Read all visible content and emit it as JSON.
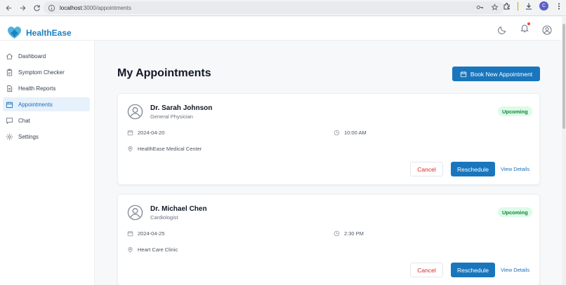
{
  "browser": {
    "url_host": "localhost",
    "url_path": ":3000/appointments",
    "profile_initial": "C"
  },
  "app": {
    "name": "HealthEase"
  },
  "sidebar": {
    "items": [
      {
        "label": "Dashboard",
        "icon": "home-icon"
      },
      {
        "label": "Symptom Checker",
        "icon": "clipboard-icon"
      },
      {
        "label": "Health Reports",
        "icon": "document-icon"
      },
      {
        "label": "Appointments",
        "icon": "calendar-icon",
        "active": true
      },
      {
        "label": "Chat",
        "icon": "chat-icon"
      },
      {
        "label": "Settings",
        "icon": "gear-icon"
      }
    ]
  },
  "main": {
    "title": "My Appointments",
    "book_button": "Book New Appointment"
  },
  "appointments": [
    {
      "doctor": "Dr. Sarah Johnson",
      "specialty": "General Physician",
      "status": "Upcoming",
      "date": "2024-04-20",
      "time": "10:00 AM",
      "location": "HealthEase Medical Center",
      "cancel": "Cancel",
      "reschedule": "Reschedule",
      "details": "View Details"
    },
    {
      "doctor": "Dr. Michael Chen",
      "specialty": "Cardiologist",
      "status": "Upcoming",
      "date": "2024-04-25",
      "time": "2:30 PM",
      "location": "Heart Care Clinic",
      "cancel": "Cancel",
      "reschedule": "Reschedule",
      "details": "View Details"
    }
  ],
  "colors": {
    "brand": "#1d7fbf",
    "primary_button": "#1976bd",
    "active_bg": "#e6f1fb",
    "badge_bg": "#dcfce7",
    "badge_text": "#15803d",
    "cancel_text": "#dc2626"
  }
}
